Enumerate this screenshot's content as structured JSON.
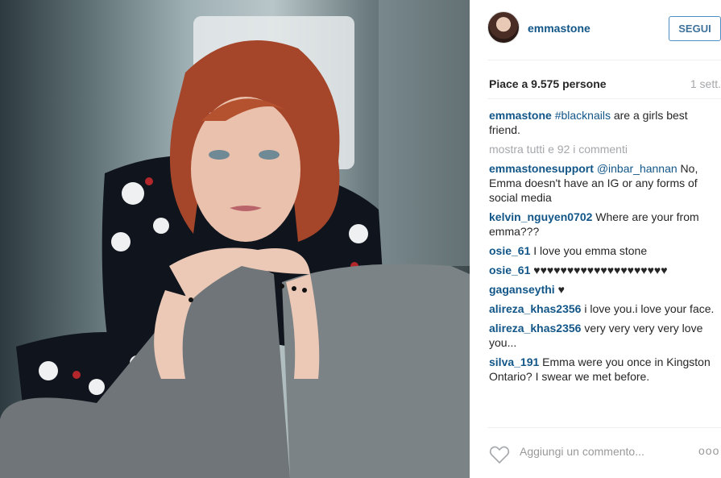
{
  "post": {
    "username": "emmastone",
    "follow_label": "SEGUI",
    "likes": "Piace a 9.575 persone",
    "age": "1 sett."
  },
  "caption": {
    "user": "emmastone",
    "tag": "#blacknails",
    "text": " are a girls best friend."
  },
  "show_all": "mostra tutti e 92 i commenti",
  "comments": [
    {
      "user": "emmastonesupport",
      "tag": "@inbar_hannan",
      "text": " No, Emma doesn't have an IG or any forms of social media"
    },
    {
      "user": "kelvin_nguyen0702",
      "text": " Where are your from emma???"
    },
    {
      "user": "osie_61",
      "text": " I love you emma stone"
    },
    {
      "user": "osie_61",
      "text": " ♥♥♥♥♥♥♥♥♥♥♥♥♥♥♥♥♥♥♥♥"
    },
    {
      "user": "gaganseythi",
      "text": " ♥"
    },
    {
      "user": "alireza_khas2356",
      "text": " i love you.i love your face."
    },
    {
      "user": "alireza_khas2356",
      "text": " very very very very love you..."
    },
    {
      "user": "silva_191",
      "text": " Emma were you once in Kingston Ontario? I swear we met before."
    }
  ],
  "footer": {
    "placeholder": "Aggiungi un commento...",
    "more": "ooo"
  },
  "icons": {
    "like": "heart-outline-icon",
    "options": "more-options-icon"
  }
}
